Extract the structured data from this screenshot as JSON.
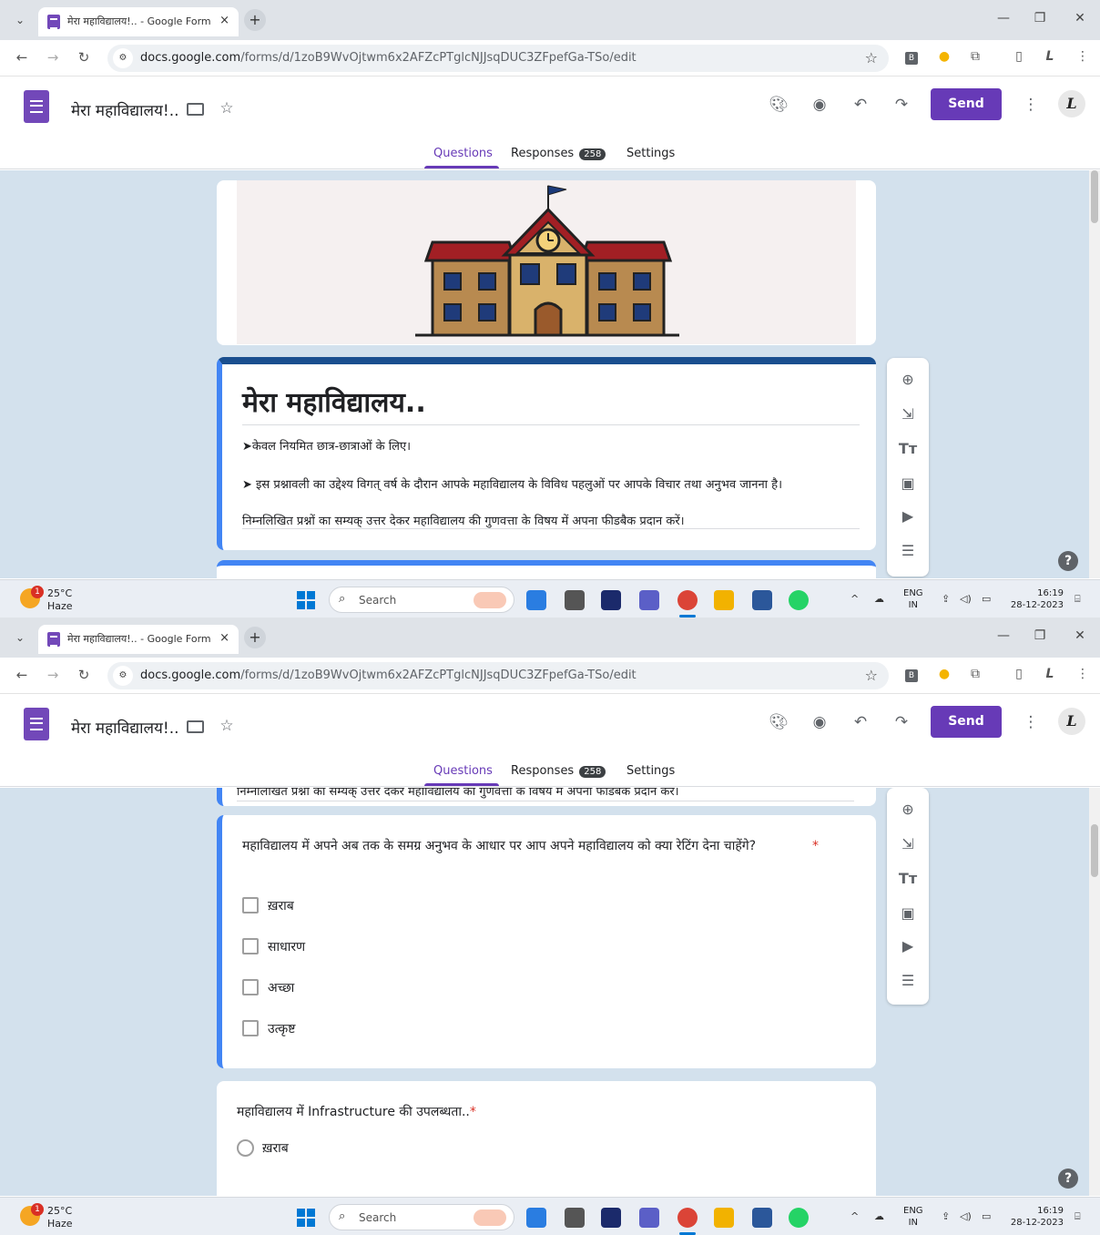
{
  "browser": {
    "tab_title": "मेरा महाविद्यालय!.. - Google Form",
    "tab_close": "×",
    "new_tab": "+",
    "url_domain": "docs.google.com",
    "url_path": "/forms/d/1zoB9WvOjtwm6x2AFZcPTglcNJJsqDUC3ZFpefGa-TSo/edit",
    "ext_badge": "B"
  },
  "forms": {
    "doc_title": "मेरा महाविद्यालय!..",
    "send_label": "Send",
    "avatar_text": "L",
    "tabs": {
      "questions": "Questions",
      "responses": "Responses",
      "responses_count": "258",
      "settings": "Settings"
    }
  },
  "header_card": {
    "title": "मेरा महाविद्यालय..",
    "desc_1": "➤केवल नियमित छात्र-छात्राओं के लिए।",
    "desc_2": "➤  इस प्रश्नावली का उद्देश्य विगत् वर्ष के दौरान आपके महाविद्यालय के विविध पहलुओं पर आपके विचार तथा अनुभव जानना है।",
    "desc_3": "निम्नलिखित प्रश्नों का सम्यक् उत्तर देकर महाविद्यालय की गुणवत्ता के विषय में अपना फीडबैक प्रदान करें।"
  },
  "question_1": {
    "text": "महाविद्यालय में अपने अब तक के समग्र अनुभव के आधार पर आप अपने महाविद्यालय को क्या रेटिंग देना चाहेंगे?",
    "required": "*",
    "options": [
      "ख़राब",
      "साधारण",
      "अच्छा",
      "उत्कृष्ट"
    ]
  },
  "question_2": {
    "text": "महाविद्यालय में Infrastructure की उपलब्धता..",
    "required": "*",
    "options": [
      "ख़राब"
    ]
  },
  "help": "?",
  "taskbar": {
    "weather_temp": "25°C",
    "weather_desc": "Haze",
    "weather_badge": "1",
    "search_placeholder": "Search",
    "lang_1": "ENG",
    "lang_2": "IN",
    "time": "16:19",
    "date": "28-12-2023"
  },
  "colors": {
    "forms_purple": "#673ab7",
    "active_blue": "#4285f4",
    "canvas_bg": "#d3e1ed",
    "required_red": "#d93025"
  }
}
